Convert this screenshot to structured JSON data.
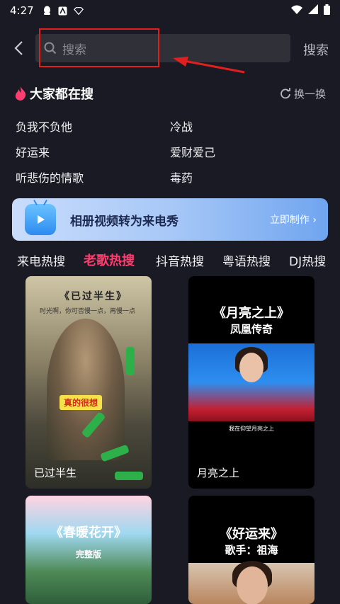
{
  "status_bar": {
    "time": "4:27"
  },
  "search": {
    "placeholder": "搜索",
    "submit_label": "搜索"
  },
  "hot": {
    "title": "大家都在搜",
    "refresh_label": "换一换",
    "items": [
      "负我不负他",
      "冷战",
      "好运来",
      "爱财爱己",
      "听悲伤的情歌",
      "毒药"
    ]
  },
  "banner": {
    "title": "相册视频转为来电秀",
    "cta": "立即制作 ›"
  },
  "tabs": [
    {
      "label": "来电热搜"
    },
    {
      "label": "老歌热搜"
    },
    {
      "label": "抖音热搜"
    },
    {
      "label": "粤语热搜"
    },
    {
      "label": "DJ热搜"
    }
  ],
  "active_tab": "老歌热搜",
  "cards": [
    {
      "label": "已过半生",
      "art_title": "《已过半生》",
      "art_sub": "时光啊，你可否慢一点，再慢一点",
      "art_bubble": "真的很想"
    },
    {
      "label": "月亮之上",
      "art_title": "《月亮之上》",
      "art_sub": "凤凰传奇",
      "art_caption": "我在仰望月亮之上"
    },
    {
      "label": "",
      "art_title": "《春暖花开》",
      "art_sub": "完整版"
    },
    {
      "label": "",
      "art_title": "《好运来》",
      "art_sub": "歌手：祖海"
    }
  ],
  "colors": {
    "background": "#1a1a24",
    "accent": "#ff3d6e",
    "search_bg": "#2f3038",
    "highlight": "#e0201f"
  }
}
